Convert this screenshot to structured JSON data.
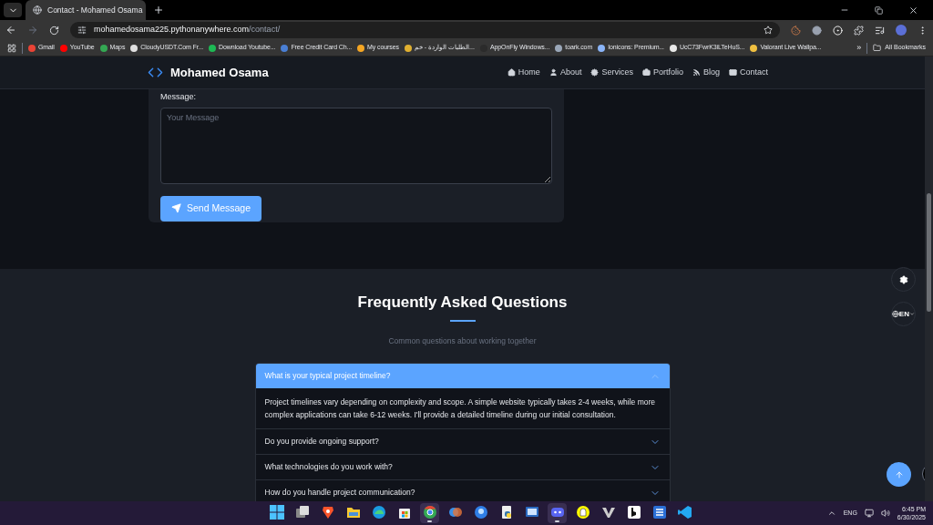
{
  "browser": {
    "tabs": [
      {
        "title": "Contact - Mohamed Osama",
        "selected": true
      }
    ],
    "address": {
      "host": "mohamedosama225.pythonanywhere.com",
      "path": "/contact/"
    },
    "bookmarks": [
      {
        "label": "Gmail",
        "color": "#ea4335"
      },
      {
        "label": "YouTube",
        "color": "#ff0000"
      },
      {
        "label": "Maps",
        "color": "#34a853"
      },
      {
        "label": "CloudyUSDT.Com Fr...",
        "color": "#e0e0e0"
      },
      {
        "label": "Download Youtube...",
        "color": "#1db954"
      },
      {
        "label": "Free Credit Card Ch...",
        "color": "#4a7fd4"
      },
      {
        "label": "My courses",
        "color": "#f5a623"
      },
      {
        "label": "الطلبات الواردة - خم...",
        "color": "#e0b030"
      },
      {
        "label": "AppOnFly Windows...",
        "color": "#2b2b2b"
      },
      {
        "label": "toark.com",
        "color": "#9aa7b8"
      },
      {
        "label": "Ionicons: Premium...",
        "color": "#8ab4f8"
      },
      {
        "label": "UcC73FwrK3iLTeHuS...",
        "color": "#e8e8e8"
      },
      {
        "label": "Valorant Live Wallpa...",
        "color": "#f0c040"
      }
    ],
    "more": "»",
    "all_bookmarks": "All Bookmarks"
  },
  "site": {
    "brand": "Mohamed Osama",
    "nav": [
      {
        "label": "Home",
        "kind": "home"
      },
      {
        "label": "About",
        "kind": "user"
      },
      {
        "label": "Services",
        "kind": "cogs"
      },
      {
        "label": "Portfolio",
        "kind": "briefcase"
      },
      {
        "label": "Blog",
        "kind": "blog"
      },
      {
        "label": "Contact",
        "kind": "mail"
      }
    ],
    "contact_form": {
      "message_label": "Message:",
      "message_placeholder": "Your Message",
      "submit": "Send Message"
    },
    "faq": {
      "title": "Frequently Asked Questions",
      "subtitle": "Common questions about working together",
      "items": [
        {
          "question": "What is your typical project timeline?",
          "expanded": true,
          "answer": "Project timelines vary depending on complexity and scope. A simple website typically takes 2-4 weeks, while more complex applications can take 6-12 weeks. I'll provide a detailed timeline during our initial consultation."
        },
        {
          "question": "Do you provide ongoing support?",
          "expanded": false
        },
        {
          "question": "What technologies do you work with?",
          "expanded": false
        },
        {
          "question": "How do you handle project communication?",
          "expanded": false
        }
      ]
    },
    "language": "EN"
  },
  "taskbar": {
    "apps": [
      {
        "kind": "start",
        "active": false
      },
      {
        "kind": "taskview",
        "active": false
      },
      {
        "kind": "brave",
        "active": false
      },
      {
        "kind": "files",
        "active": false
      },
      {
        "kind": "edge",
        "active": false
      },
      {
        "kind": "store",
        "active": false
      },
      {
        "kind": "chrome",
        "active": true
      },
      {
        "kind": "copilot",
        "active": false
      },
      {
        "kind": "circle",
        "active": false
      },
      {
        "kind": "python",
        "active": false
      },
      {
        "kind": "remote",
        "active": false
      },
      {
        "kind": "discord",
        "active": true
      },
      {
        "kind": "snapchat",
        "active": false
      },
      {
        "kind": "valorant",
        "active": false
      },
      {
        "kind": "bing",
        "active": false
      },
      {
        "kind": "script",
        "active": false
      },
      {
        "kind": "vscode",
        "active": false
      }
    ],
    "language": "ENG",
    "time": "6:45 PM",
    "date": "6/30/2025"
  }
}
